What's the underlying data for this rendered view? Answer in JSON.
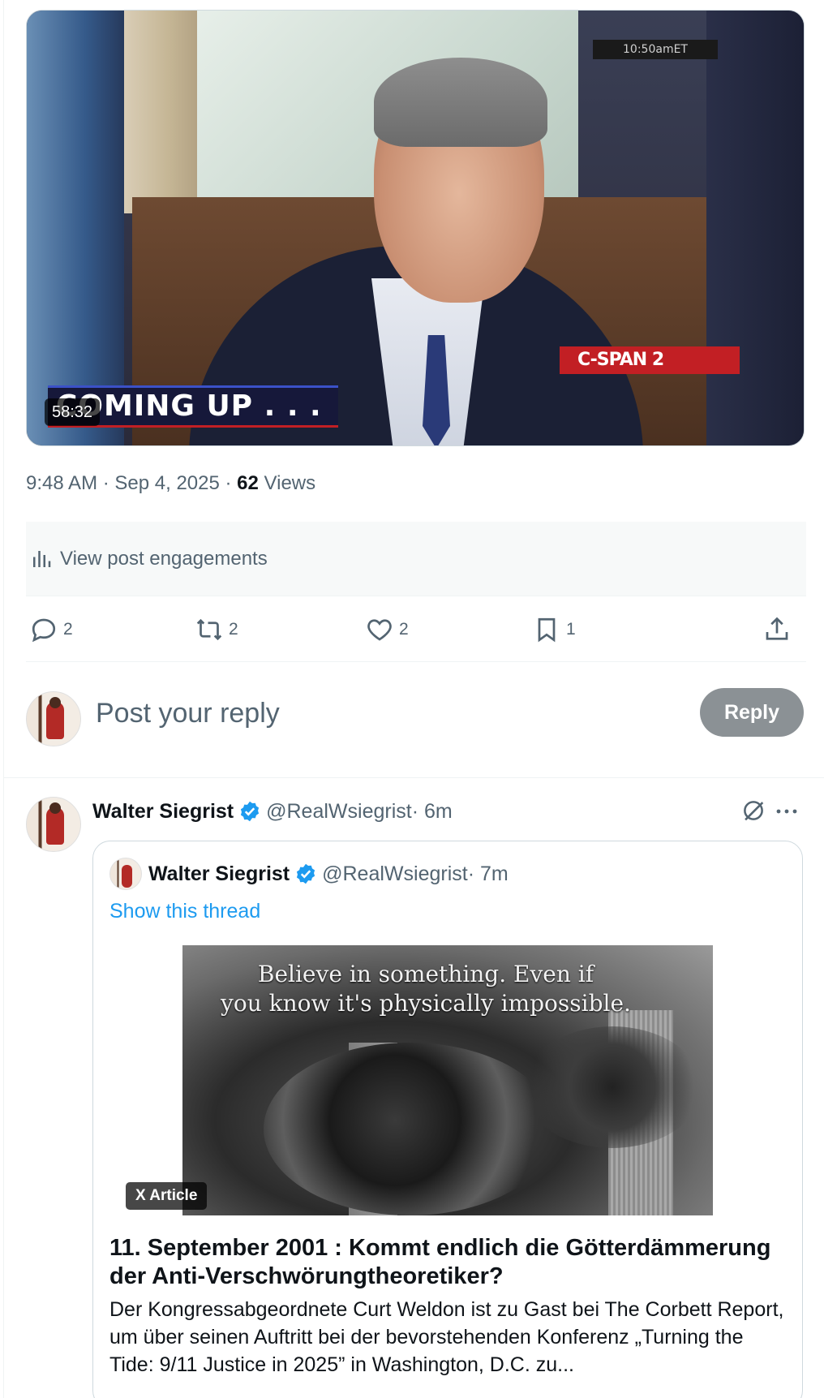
{
  "video": {
    "duration": "58:32",
    "overlay_timestamp": "10:50amET",
    "network_label": "C-SPAN 2",
    "banner_text": "COMING UP . . ."
  },
  "post_meta": {
    "time": "9:48 AM",
    "separator1": " · ",
    "date": "Sep 4, 2025",
    "separator2": " · ",
    "views_count": "62",
    "views_label": " Views"
  },
  "engagements": {
    "label": "View post engagements"
  },
  "actions": {
    "replies": "2",
    "reposts": "2",
    "likes": "2",
    "bookmarks": "1"
  },
  "reply_box": {
    "placeholder": "Post your reply",
    "button_label": "Reply"
  },
  "reply_post": {
    "author_name": "Walter Siegrist",
    "handle": "@RealWsiegrist",
    "time": " · 6m",
    "quoted": {
      "author_name": "Walter Siegrist",
      "handle": "@RealWsiegrist",
      "time": " · 7m",
      "show_thread": "Show this thread",
      "image_text_line1": "Believe in something.  Even if",
      "image_text_line2": "you know it's physically impossible.",
      "badge": "X Article",
      "article_title": "11. September 2001 : Kommt endlich die Götterdämmerung der Anti-Verschwörungtheoretiker?",
      "article_excerpt": "Der Kongressabgeordnete Curt Weldon ist zu Gast bei The Corbett Report, um über seinen Auftritt bei der bevorstehenden Konferenz „Turning the Tide: 9/11 Justice in 2025” in Washington, D.C. zu..."
    }
  },
  "colors": {
    "accent": "#1d9bf0",
    "verified": "#1d9bf0",
    "muted_text": "#536471",
    "reply_button_disabled": "#8b9195"
  },
  "icons": [
    "reply-icon",
    "repost-icon",
    "like-icon",
    "bookmark-icon",
    "share-icon",
    "analytics-icon",
    "verified-badge-icon",
    "grok-icon",
    "more-icon"
  ]
}
